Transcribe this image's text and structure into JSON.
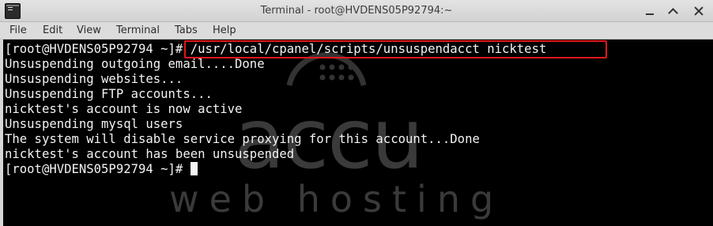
{
  "window": {
    "title": "Terminal - root@HVDENS05P92794:~",
    "controls": [
      "minimize",
      "maximize",
      "close"
    ]
  },
  "menu": {
    "items": [
      {
        "label": "File"
      },
      {
        "label": "Edit"
      },
      {
        "label": "View"
      },
      {
        "label": "Terminal"
      },
      {
        "label": "Tabs"
      },
      {
        "label": "Help"
      }
    ]
  },
  "terminal": {
    "lines": [
      "[root@HVDENS05P92794 ~]# /usr/local/cpanel/scripts/unsuspendacct nicktest",
      "Unsuspending outgoing email....Done",
      "Unsuspending websites...",
      "Unsuspending FTP accounts...",
      "nicktest's account is now active",
      "Unsuspending mysql users",
      "The system will disable service proxying for this account...Done",
      "nicktest's account has been unsuspended",
      "[root@HVDENS05P92794 ~]# "
    ],
    "highlight_color": "#e0161c"
  },
  "watermark": {
    "brand": "accu",
    "tagline": "web hosting"
  },
  "colors": {
    "terminal_bg": "#000000",
    "terminal_fg": "#f2f2f2",
    "titlebar_bg": "#dcdcdc"
  }
}
